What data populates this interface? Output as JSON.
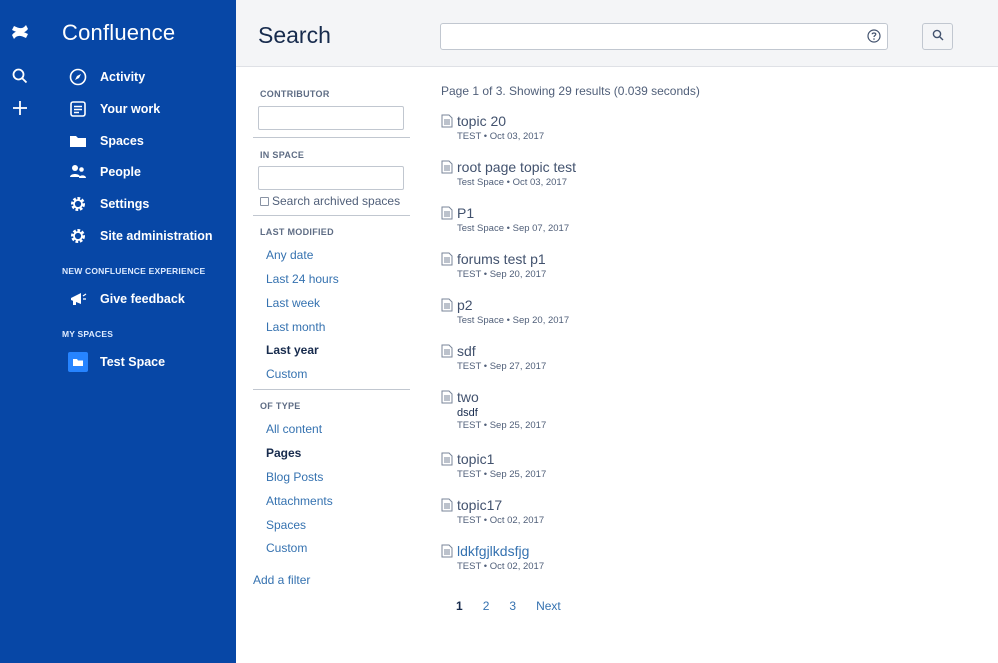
{
  "app": {
    "title": "Confluence"
  },
  "sidebar": {
    "items": [
      {
        "label": "Activity",
        "icon": "compass-icon"
      },
      {
        "label": "Your work",
        "icon": "document-icon"
      },
      {
        "label": "Spaces",
        "icon": "folder-icon"
      },
      {
        "label": "People",
        "icon": "people-icon"
      },
      {
        "label": "Settings",
        "icon": "gear-icon"
      },
      {
        "label": "Site administration",
        "icon": "gear-icon"
      }
    ],
    "new_experience_title": "NEW CONFLUENCE EXPERIENCE",
    "feedback_label": "Give feedback",
    "my_spaces_title": "MY SPACES",
    "spaces": [
      {
        "label": "Test Space"
      }
    ]
  },
  "header": {
    "title": "Search",
    "search_value": "",
    "colors": {
      "brand": "#0747a6",
      "link": "#3572b0"
    }
  },
  "filters": {
    "contributor_label": "CONTRIBUTOR",
    "contributor_value": "",
    "in_space_label": "IN SPACE",
    "in_space_value": "",
    "archived_label": "Search archived spaces",
    "archived_checked": false,
    "last_modified_label": "LAST MODIFIED",
    "last_modified": [
      {
        "label": "Any date",
        "active": false
      },
      {
        "label": "Last 24 hours",
        "active": false
      },
      {
        "label": "Last week",
        "active": false
      },
      {
        "label": "Last month",
        "active": false
      },
      {
        "label": "Last year",
        "active": true
      },
      {
        "label": "Custom",
        "active": false
      }
    ],
    "of_type_label": "OF TYPE",
    "of_type": [
      {
        "label": "All content",
        "active": false
      },
      {
        "label": "Pages",
        "active": true
      },
      {
        "label": "Blog Posts",
        "active": false
      },
      {
        "label": "Attachments",
        "active": false
      },
      {
        "label": "Spaces",
        "active": false
      },
      {
        "label": "Custom",
        "active": false
      }
    ],
    "add_filter_label": "Add a filter"
  },
  "results": {
    "summary": "Page 1 of 3. Showing 29 results (0.039 seconds)",
    "items": [
      {
        "title": "topic 20",
        "meta": "TEST • Oct 03, 2017"
      },
      {
        "title": "root page topic test",
        "meta": "Test Space • Oct 03, 2017"
      },
      {
        "title": "P1",
        "meta": "Test Space • Sep 07, 2017"
      },
      {
        "title": "forums test p1",
        "meta": "TEST • Sep 20, 2017"
      },
      {
        "title": "p2",
        "meta": "Test Space • Sep 20, 2017"
      },
      {
        "title": "sdf",
        "meta": "TEST • Sep 27, 2017"
      },
      {
        "title": "two",
        "excerpt": "dsdf",
        "meta": "TEST • Sep 25, 2017"
      },
      {
        "title": "topic1",
        "meta": "TEST • Sep 25, 2017"
      },
      {
        "title": "topic17",
        "meta": "TEST • Oct 02, 2017"
      },
      {
        "title": "ldkfgjlkdsfjg",
        "meta": "TEST • Oct 02, 2017"
      }
    ]
  },
  "pagination": {
    "pages": [
      "1",
      "2",
      "3"
    ],
    "current": "1",
    "next_label": "Next"
  }
}
